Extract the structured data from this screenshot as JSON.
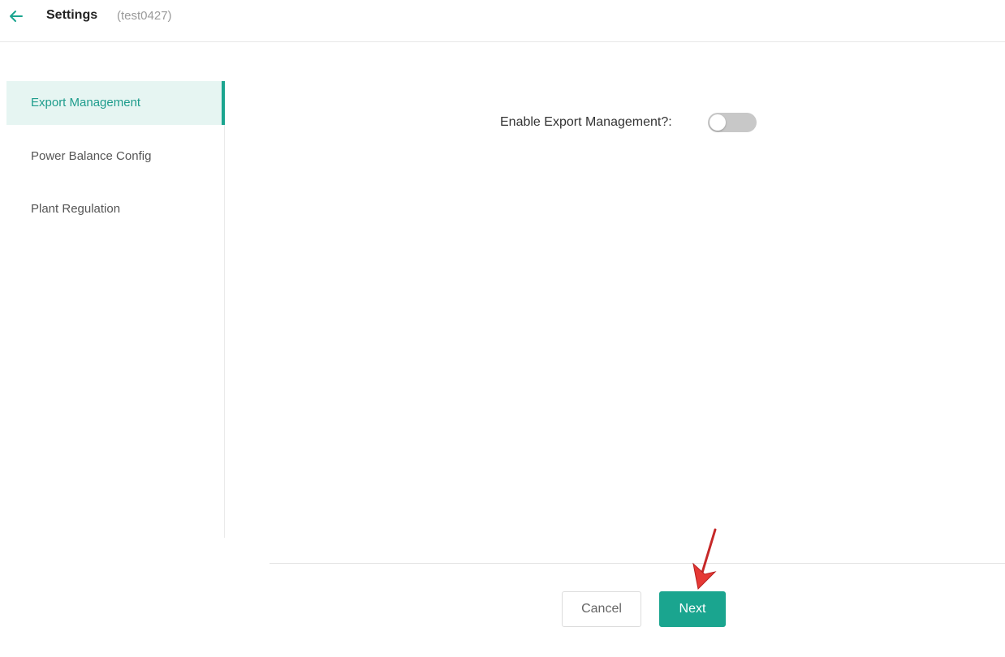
{
  "header": {
    "title": "Settings",
    "subtitle": "(test0427)",
    "back_icon": "arrow-left-icon"
  },
  "sidebar": {
    "items": [
      {
        "label": "Export Management",
        "active": true
      },
      {
        "label": "Power Balance Config",
        "active": false
      },
      {
        "label": "Plant Regulation",
        "active": false
      }
    ]
  },
  "main": {
    "toggle_label": "Enable Export Management?:",
    "toggle_on": false
  },
  "footer": {
    "cancel_label": "Cancel",
    "next_label": "Next"
  },
  "colors": {
    "accent": "#1aa58f",
    "active_bg": "#e6f5f2",
    "annotation": "#e53935"
  }
}
